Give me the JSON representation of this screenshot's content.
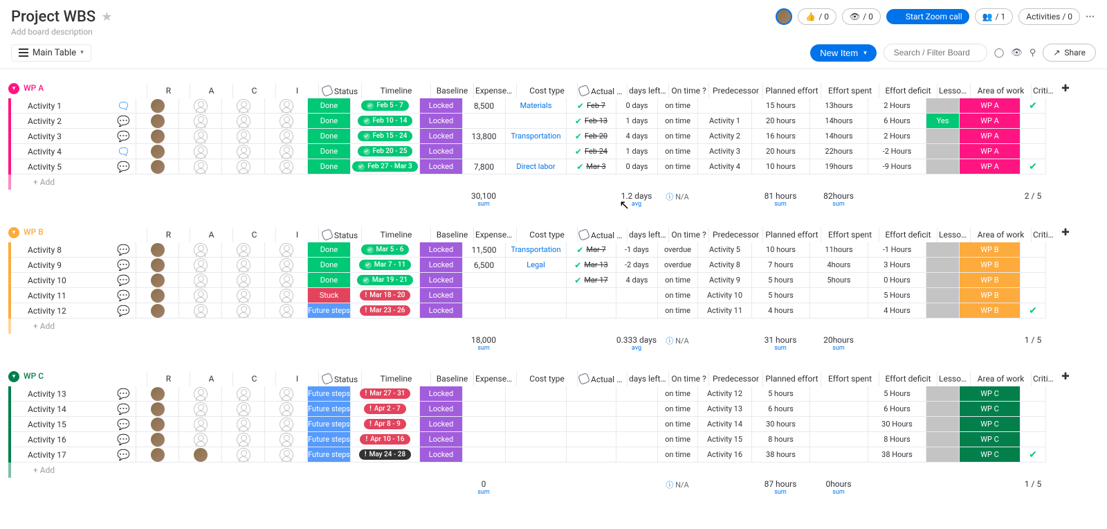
{
  "header": {
    "title": "Project WBS",
    "desc": "Add board description",
    "like_count": "/ 0",
    "view_count": "/ 0",
    "zoom_label": "Start Zoom call",
    "people_count": "/ 1",
    "activities_label": "Activities / 0"
  },
  "toolbar": {
    "view_label": "Main Table",
    "new_item": "New Item",
    "search_placeholder": "Search / Filter Board",
    "share_label": "Share"
  },
  "columns": {
    "r": "R",
    "a": "A",
    "c": "C",
    "i": "I",
    "status": "Status",
    "timeline": "Timeline",
    "baseline": "Baseline",
    "expenses": "Expenses...",
    "cost_type": "Cost type",
    "actual_date": "Actual Dat...",
    "days_left": "days left/delay",
    "on_time": "On time ?",
    "predecessor": "Predecessor",
    "planned_effort": "Planned effort",
    "effort_spent": "Effort spent",
    "effort_deficit": "Effort deficit",
    "lesson": "Lesson L...",
    "area": "Area of work",
    "critical": "Critical"
  },
  "status_colors": {
    "Done": "#00c875",
    "Stuck": "#e2445c",
    "Future steps": "#579bfc"
  },
  "timeline_colors": {
    "done": "#00c875",
    "warn": "#e2445c",
    "dark": "#333333"
  },
  "lesson_colors": {
    "Yes": "#00c875",
    "": "#c4c4c4"
  },
  "add_row": "+ Add",
  "groups": [
    {
      "name": "WP A",
      "color": "#ff1581",
      "area_color": "#ff1581",
      "rows": [
        {
          "name": "Activity 1",
          "chat": "blue",
          "r": "av",
          "status": "Done",
          "timeline": "Feb 5 - 7",
          "tl_style": "done",
          "baseline": "Locked",
          "expenses": "8,500",
          "cost_type": "Materials",
          "actual": "Feb 7",
          "ok": true,
          "days_left": "0 days",
          "on_time": "on time",
          "predecessor": "",
          "planned": "15 hours",
          "spent": "13hours",
          "deficit": "2 Hours",
          "lesson": "",
          "area": "WP A",
          "critical": true
        },
        {
          "name": "Activity 2",
          "chat": "",
          "r": "av",
          "status": "Done",
          "timeline": "Feb 10 - 14",
          "tl_style": "done",
          "baseline": "Locked",
          "expenses": "",
          "cost_type": "",
          "actual": "Feb 13",
          "ok": true,
          "days_left": "1 days",
          "on_time": "on time",
          "predecessor": "Activity 1",
          "planned": "20 hours",
          "spent": "14hours",
          "deficit": "6 Hours",
          "lesson": "Yes",
          "area": "WP A",
          "critical": false
        },
        {
          "name": "Activity 3",
          "chat": "",
          "r": "av",
          "status": "Done",
          "timeline": "Feb 15 - 24",
          "tl_style": "done",
          "baseline": "Locked",
          "expenses": "13,800",
          "cost_type": "Transportation",
          "actual": "Feb 20",
          "ok": true,
          "days_left": "4 days",
          "on_time": "on time",
          "predecessor": "Activity 2",
          "planned": "16 hours",
          "spent": "14hours",
          "deficit": "2 Hours",
          "lesson": "",
          "area": "WP A",
          "critical": false
        },
        {
          "name": "Activity 4",
          "chat": "blue",
          "r": "av",
          "status": "Done",
          "timeline": "Feb 20 - 25",
          "tl_style": "done",
          "baseline": "Locked",
          "expenses": "",
          "cost_type": "",
          "actual": "Feb 24",
          "ok": true,
          "days_left": "1 days",
          "on_time": "on time",
          "predecessor": "Activity 3",
          "planned": "20 hours",
          "spent": "22hours",
          "deficit": "-2 Hours",
          "lesson": "",
          "area": "WP A",
          "critical": false
        },
        {
          "name": "Activity 5",
          "chat": "",
          "r": "av",
          "status": "Done",
          "timeline": "Feb 27 - Mar 3",
          "tl_style": "done",
          "baseline": "Locked",
          "expenses": "7,800",
          "cost_type": "Direct labor",
          "actual": "Mar 3",
          "ok": true,
          "days_left": "0 days",
          "on_time": "on time",
          "predecessor": "Activity 4",
          "planned": "10 hours",
          "spent": "19hours",
          "deficit": "-9 Hours",
          "lesson": "",
          "area": "WP A",
          "critical": true
        }
      ],
      "summary": {
        "expenses": "30,100",
        "days_left": "1.2 days",
        "on_time": "N/A",
        "planned": "81 hours",
        "spent": "82hours",
        "critical": "2 / 5"
      }
    },
    {
      "name": "WP B",
      "color": "#fdab3d",
      "area_color": "#fdab3d",
      "rows": [
        {
          "name": "Activity 8",
          "chat": "",
          "r": "av",
          "status": "Done",
          "timeline": "Mar 5 - 6",
          "tl_style": "done",
          "baseline": "Locked",
          "expenses": "11,500",
          "cost_type": "Transportation",
          "actual": "Mar 7",
          "ok": true,
          "days_left": "-1 days",
          "on_time": "overdue",
          "predecessor": "Activity 5",
          "planned": "10 hours",
          "spent": "11hours",
          "deficit": "-1 Hours",
          "lesson": "",
          "area": "WP B",
          "critical": false
        },
        {
          "name": "Activity 9",
          "chat": "",
          "r": "av",
          "status": "Done",
          "timeline": "Mar 7 - 11",
          "tl_style": "done",
          "baseline": "Locked",
          "expenses": "6,500",
          "cost_type": "Legal",
          "actual": "Mar 13",
          "ok": true,
          "days_left": "-2 days",
          "on_time": "overdue",
          "predecessor": "Activity 8",
          "planned": "7 hours",
          "spent": "4hours",
          "deficit": "3 Hours",
          "lesson": "",
          "area": "WP B",
          "critical": false
        },
        {
          "name": "Activity 10",
          "chat": "",
          "r": "av",
          "status": "Done",
          "timeline": "Mar 19 - 21",
          "tl_style": "done",
          "baseline": "Locked",
          "expenses": "",
          "cost_type": "",
          "actual": "Mar 17",
          "ok": true,
          "days_left": "4 days",
          "on_time": "on time",
          "predecessor": "Activity 9",
          "planned": "5 hours",
          "spent": "5hours",
          "deficit": "0 Hours",
          "lesson": "",
          "area": "WP B",
          "critical": false
        },
        {
          "name": "Activity 11",
          "chat": "",
          "r": "av",
          "status": "Stuck",
          "timeline": "Mar 18 - 20",
          "tl_style": "warn",
          "baseline": "Locked",
          "expenses": "",
          "cost_type": "",
          "actual": "",
          "ok": false,
          "days_left": "",
          "on_time": "on time",
          "predecessor": "Activity 10",
          "planned": "5 hours",
          "spent": "",
          "deficit": "5 Hours",
          "lesson": "",
          "area": "WP B",
          "critical": false
        },
        {
          "name": "Activity 12",
          "chat": "",
          "r": "av",
          "status": "Future steps",
          "timeline": "Mar 23 - 26",
          "tl_style": "warn",
          "baseline": "Locked",
          "expenses": "",
          "cost_type": "",
          "actual": "",
          "ok": false,
          "days_left": "",
          "on_time": "on time",
          "predecessor": "Activity 11",
          "planned": "4 hours",
          "spent": "",
          "deficit": "4 Hours",
          "lesson": "",
          "area": "WP B",
          "critical": true
        }
      ],
      "summary": {
        "expenses": "18,000",
        "days_left": "0.333 days",
        "on_time": "N/A",
        "planned": "31 hours",
        "spent": "20hours",
        "critical": "1 / 5"
      }
    },
    {
      "name": "WP C",
      "color": "#037f4c",
      "area_color": "#037f4c",
      "rows": [
        {
          "name": "Activity 13",
          "chat": "",
          "r": "av",
          "status": "Future steps",
          "timeline": "Mar 27 - 31",
          "tl_style": "warn",
          "baseline": "Locked",
          "expenses": "",
          "cost_type": "",
          "actual": "",
          "ok": false,
          "days_left": "",
          "on_time": "on time",
          "predecessor": "Activity 12",
          "planned": "5 hours",
          "spent": "",
          "deficit": "5 Hours",
          "lesson": "",
          "area": "WP C",
          "critical": false
        },
        {
          "name": "Activity 14",
          "chat": "",
          "r": "av",
          "status": "Future steps",
          "timeline": "Apr 2 - 7",
          "tl_style": "warn",
          "baseline": "Locked",
          "expenses": "",
          "cost_type": "",
          "actual": "",
          "ok": false,
          "days_left": "",
          "on_time": "on time",
          "predecessor": "Activity 13",
          "planned": "6 hours",
          "spent": "",
          "deficit": "6 Hours",
          "lesson": "",
          "area": "WP C",
          "critical": false
        },
        {
          "name": "Activity 15",
          "chat": "",
          "r": "av",
          "status": "Future steps",
          "timeline": "Apr 8 - 9",
          "tl_style": "warn",
          "baseline": "Locked",
          "expenses": "",
          "cost_type": "",
          "actual": "",
          "ok": false,
          "days_left": "",
          "on_time": "on time",
          "predecessor": "Activity 14",
          "planned": "30 hours",
          "spent": "",
          "deficit": "30 Hours",
          "lesson": "",
          "area": "WP C",
          "critical": false
        },
        {
          "name": "Activity 16",
          "chat": "",
          "r": "av",
          "status": "Future steps",
          "timeline": "Apr 10 - 16",
          "tl_style": "warn",
          "baseline": "Locked",
          "expenses": "",
          "cost_type": "",
          "actual": "",
          "ok": false,
          "days_left": "",
          "on_time": "on time",
          "predecessor": "Activity 15",
          "planned": "8 hours",
          "spent": "",
          "deficit": "8 Hours",
          "lesson": "",
          "area": "WP C",
          "critical": false
        },
        {
          "name": "Activity 17",
          "chat": "",
          "r": "av",
          "a": "av",
          "status": "Future steps",
          "timeline": "May 24 - 28",
          "tl_style": "dark",
          "baseline": "Locked",
          "expenses": "",
          "cost_type": "",
          "actual": "",
          "ok": false,
          "days_left": "",
          "on_time": "on time",
          "predecessor": "Activity 16",
          "planned": "38 hours",
          "spent": "",
          "deficit": "38 Hours",
          "lesson": "",
          "area": "WP C",
          "critical": true
        }
      ],
      "summary": {
        "expenses": "0",
        "days_left": "",
        "on_time": "N/A",
        "planned": "87 hours",
        "spent": "0hours",
        "critical": "1 / 5"
      }
    }
  ],
  "sum_labels": {
    "sum": "sum",
    "avg": "avg"
  }
}
